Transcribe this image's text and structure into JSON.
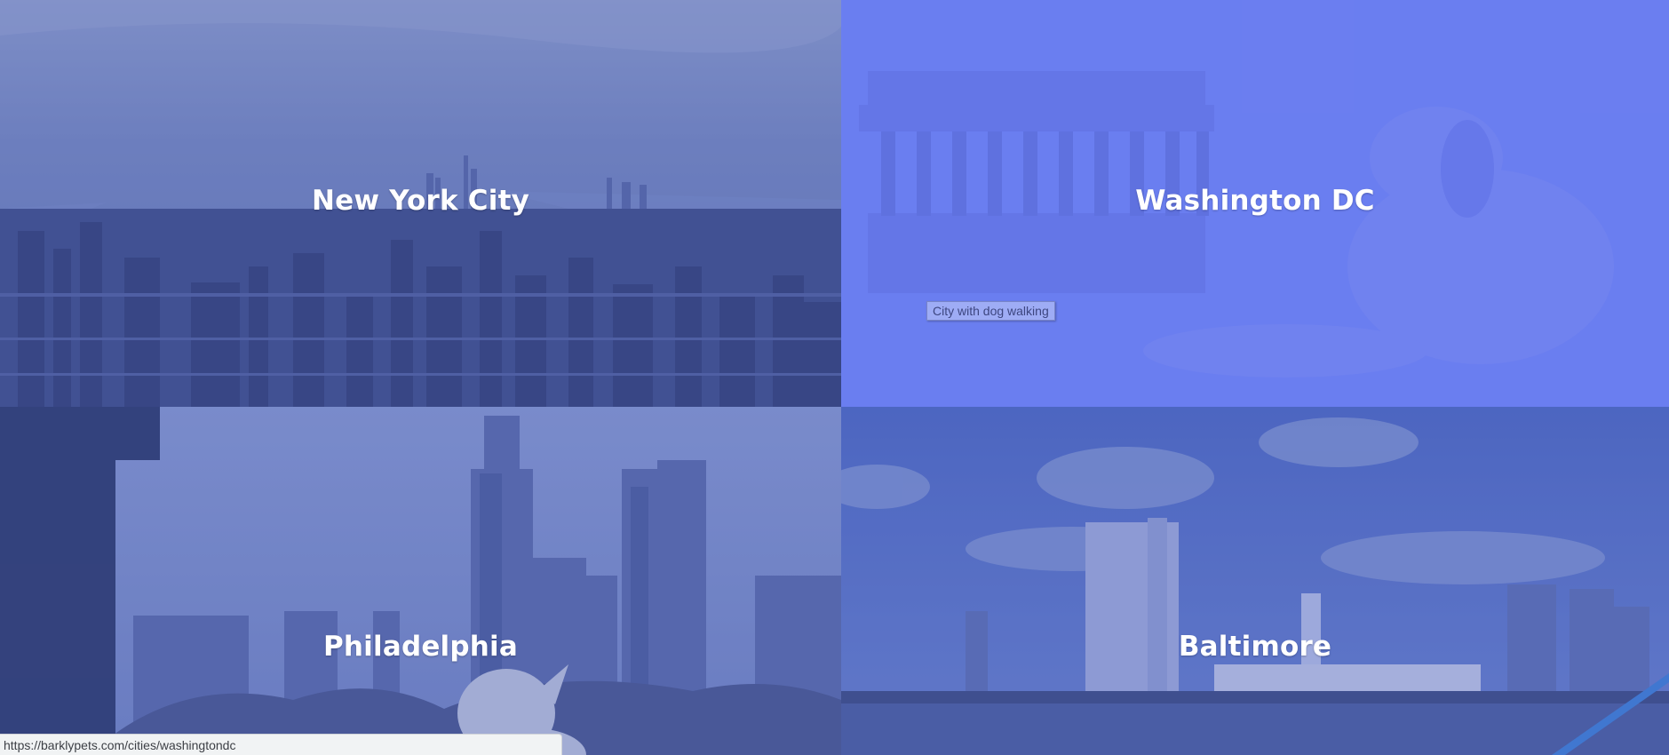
{
  "cities": {
    "nyc": {
      "name": "New York City"
    },
    "dc": {
      "name": "Washington DC"
    },
    "philadelphia": {
      "name": "Philadelphia"
    },
    "baltimore": {
      "name": "Baltimore"
    }
  },
  "tooltip": {
    "text": "City with dog walking"
  },
  "status_bar": {
    "url": "https://barklypets.com/cities/washingtondc"
  },
  "colors": {
    "overlay_blue": "#4a5fb8",
    "overlay_bright": "#6b7ef0",
    "title_text": "#ffffff"
  },
  "images": {
    "nyc": "aerial-skyline-photo",
    "dc": "lincoln-memorial-dog-photo",
    "philadelphia": "skyline-french-bulldog-photo",
    "baltimore": "harbor-skyline-photo"
  }
}
